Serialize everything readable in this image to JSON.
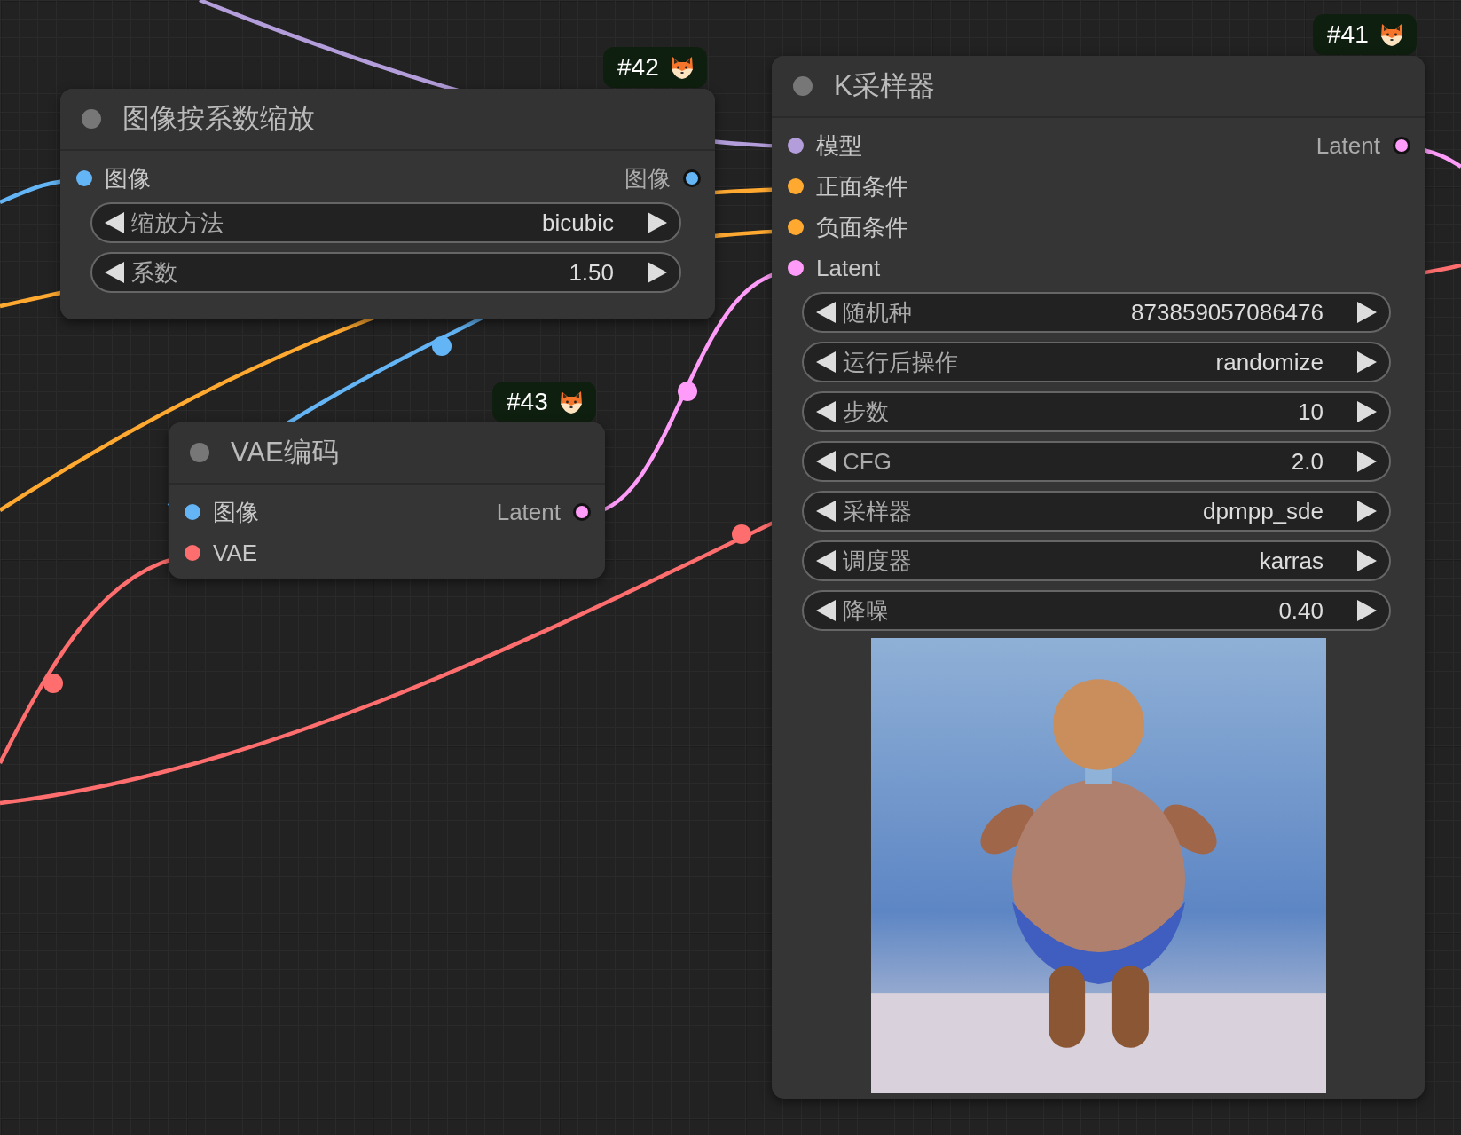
{
  "nodes": [
    {
      "badge": "#42",
      "title": "图像按系数缩放",
      "inputs": [
        {
          "label": "图像",
          "color": "#64b5f6"
        }
      ],
      "outputs": [
        {
          "label": "图像",
          "color": "#64b5f6"
        }
      ],
      "widgets": [
        {
          "label": "缩放方法",
          "value": "bicubic"
        },
        {
          "label": "系数",
          "value": "1.50"
        }
      ]
    },
    {
      "badge": "#41",
      "title": "K采样器",
      "inputs": [
        {
          "label": "模型",
          "color": "#b39ddb"
        },
        {
          "label": "正面条件",
          "color": "#ffa931"
        },
        {
          "label": "负面条件",
          "color": "#ffa931"
        },
        {
          "label": "Latent",
          "color": "#ff9cf9"
        }
      ],
      "outputs": [
        {
          "label": "Latent",
          "color": "#ff9cf9"
        }
      ],
      "widgets": [
        {
          "label": "随机种",
          "value": "873859057086476"
        },
        {
          "label": "运行后操作",
          "value": "randomize"
        },
        {
          "label": "步数",
          "value": "10"
        },
        {
          "label": "CFG",
          "value": "2.0"
        },
        {
          "label": "采样器",
          "value": "dpmpp_sde"
        },
        {
          "label": "调度器",
          "value": "karras"
        },
        {
          "label": "降噪",
          "value": "0.40"
        }
      ],
      "preview": {
        "kind": "picture"
      }
    },
    {
      "badge": "#43",
      "title": "VAE编码",
      "inputs": [
        {
          "label": "图像",
          "color": "#64b5f6"
        },
        {
          "label": "VAE",
          "color": "#ff6e6e"
        }
      ],
      "outputs": [
        {
          "label": "Latent",
          "color": "#ff9cf9"
        }
      ]
    }
  ]
}
